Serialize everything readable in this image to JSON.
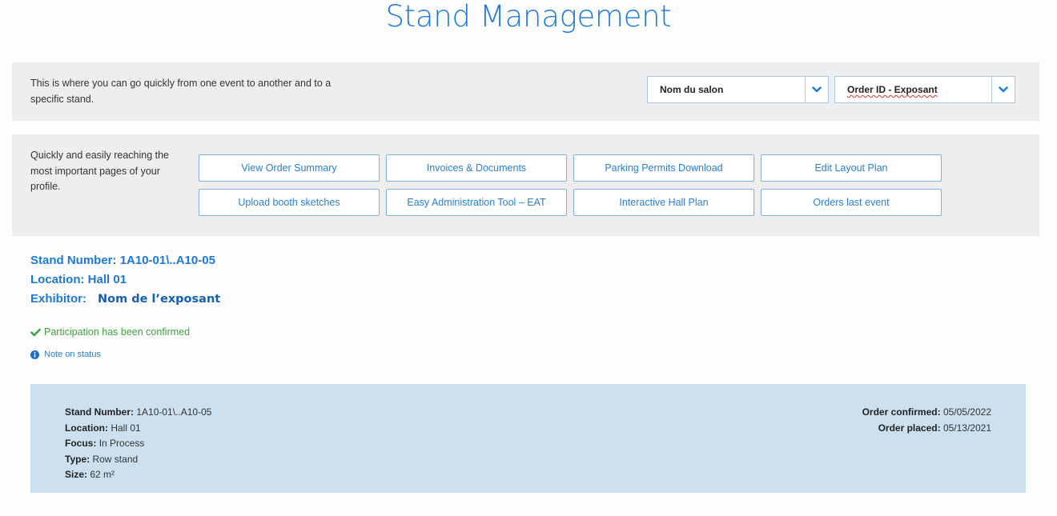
{
  "header": {
    "title": "Stand Management"
  },
  "event_nav": {
    "description": "This is where you can go quickly from one event to another and to a specific stand.",
    "event_select": {
      "value": "Nom du salon",
      "icon": "chevron-down-icon"
    },
    "order_select": {
      "value": "Order ID - Exposant",
      "icon": "chevron-down-icon"
    }
  },
  "quick_links": {
    "description": "Quickly and easily reaching the most important pages of your profile.",
    "buttons": [
      {
        "label": "View Order Summary"
      },
      {
        "label": "Invoices & Documents"
      },
      {
        "label": "Parking Permits Download"
      },
      {
        "label": "Edit Layout Plan"
      },
      {
        "label": "Upload booth sketches"
      },
      {
        "label": "Easy Administration Tool – EAT"
      },
      {
        "label": "Interactive Hall Plan"
      },
      {
        "label": "Orders last event"
      }
    ]
  },
  "stand_summary": {
    "stand_number_label": "Stand Number:",
    "stand_number": "1A10-01\\..A10-05",
    "location_label": "Location:",
    "location": "Hall 01",
    "exhibitor_label": "Exhibitor:",
    "exhibitor": "Nom de l’exposant"
  },
  "status": {
    "confirmed_text": "Participation has been confirmed",
    "confirmed_icon": "check-icon",
    "confirmed_color": "#3fa33f",
    "note_text": "Note on status",
    "note_icon": "info-circle-icon"
  },
  "details": {
    "left": [
      {
        "label": "Stand Number:",
        "value": "1A10-01\\..A10-05"
      },
      {
        "label": "Location:",
        "value": "Hall 01"
      },
      {
        "label": "Focus:",
        "value": "In Process"
      },
      {
        "label": "Type:",
        "value": "Row stand"
      },
      {
        "label": "Size:",
        "value": "62 m²"
      }
    ],
    "right": [
      {
        "label": "Order confirmed:",
        "value": "05/05/2022"
      },
      {
        "label": "Order placed:",
        "value": "05/13/2021"
      }
    ]
  },
  "colors": {
    "accent": "#1c7ad6",
    "panel_bg": "#eeeeee",
    "detail_bg": "#cce0f0"
  }
}
